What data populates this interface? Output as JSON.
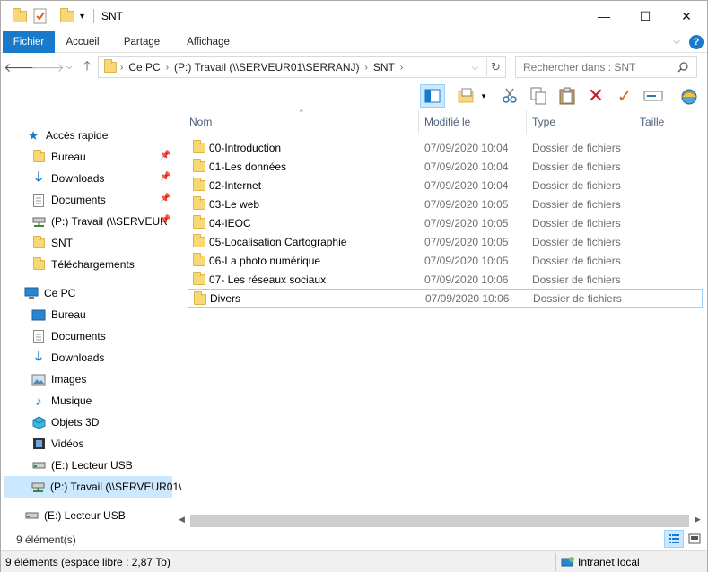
{
  "window": {
    "title": "SNT",
    "minimize": "—",
    "maximize": "☐",
    "close": "✕"
  },
  "ribbon": {
    "tabs": [
      "Fichier",
      "Accueil",
      "Partage",
      "Affichage"
    ],
    "help": "?"
  },
  "address": {
    "crumbs": [
      "Ce PC",
      "(P:) Travail (\\\\SERVEUR01\\SERRANJ)",
      "SNT"
    ]
  },
  "search": {
    "placeholder": "Rechercher dans : SNT"
  },
  "nav": {
    "quick_access": "Accès rapide",
    "quick_items": [
      "Bureau",
      "Downloads",
      "Documents",
      "(P:) Travail (\\\\SERVEUR",
      "SNT",
      "Téléchargements"
    ],
    "this_pc": "Ce PC",
    "pc_items": [
      "Bureau",
      "Documents",
      "Downloads",
      "Images",
      "Musique",
      "Objets 3D",
      "Vidéos",
      "(E:) Lecteur USB",
      "(P:) Travail (\\\\SERVEUR01\\"
    ],
    "usb": "(E:) Lecteur USB"
  },
  "columns": {
    "name": "Nom",
    "modified": "Modifié le",
    "type": "Type",
    "size": "Taille"
  },
  "files": [
    {
      "name": "00-Introduction",
      "modified": "07/09/2020 10:04",
      "type": "Dossier de fichiers"
    },
    {
      "name": "01-Les données",
      "modified": "07/09/2020 10:04",
      "type": "Dossier de fichiers"
    },
    {
      "name": "02-Internet",
      "modified": "07/09/2020 10:04",
      "type": "Dossier de fichiers"
    },
    {
      "name": "03-Le web",
      "modified": "07/09/2020 10:05",
      "type": "Dossier de fichiers"
    },
    {
      "name": "04-IEOC",
      "modified": "07/09/2020 10:05",
      "type": "Dossier de fichiers"
    },
    {
      "name": "05-Localisation Cartographie",
      "modified": "07/09/2020 10:05",
      "type": "Dossier de fichiers"
    },
    {
      "name": "06-La photo numérique",
      "modified": "07/09/2020 10:05",
      "type": "Dossier de fichiers"
    },
    {
      "name": "07- Les réseaux sociaux",
      "modified": "07/09/2020 10:06",
      "type": "Dossier de fichiers"
    },
    {
      "name": "Divers",
      "modified": "07/09/2020 10:06",
      "type": "Dossier de fichiers"
    }
  ],
  "status": {
    "count": "9 élément(s)",
    "free_space": "9 éléments (espace libre : 2,87 To)",
    "zone": "Intranet local"
  },
  "colors": {
    "accent": "#1979ca",
    "selection": "#cce8ff",
    "folder": "#f8d775"
  }
}
